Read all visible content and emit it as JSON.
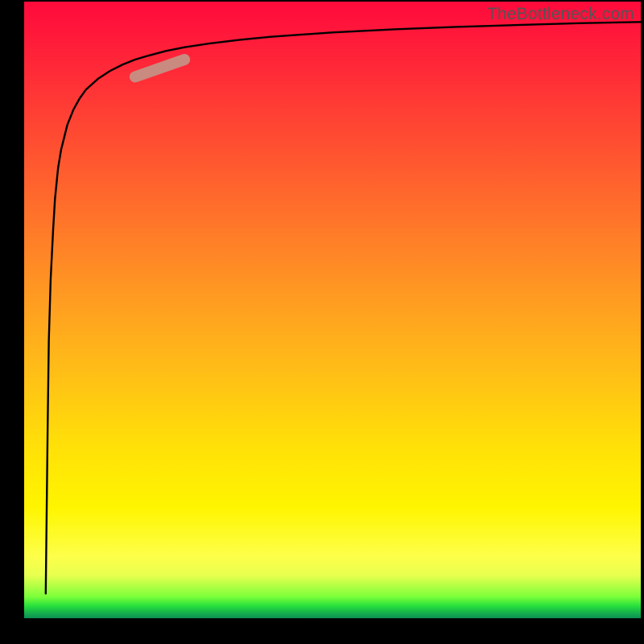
{
  "watermark": "TheBottleneck.com",
  "colors": {
    "curve": "#000000",
    "marker_fill": "#c98a80",
    "marker_stroke": "#a56a60",
    "frame": "#000000"
  },
  "chart_data": {
    "type": "line",
    "title": "",
    "xlabel": "",
    "ylabel": "",
    "xlim": [
      0,
      100
    ],
    "ylim": [
      0,
      100
    ],
    "series": [
      {
        "name": "curve",
        "x": [
          3.5,
          3.8,
          4,
          4.3,
          4.7,
          5,
          5.5,
          6,
          7,
          8,
          9,
          10,
          12,
          14,
          16,
          18,
          20,
          23,
          26,
          30,
          35,
          40,
          50,
          60,
          70,
          80,
          90,
          100
        ],
        "y": [
          4,
          30,
          45,
          55,
          63,
          68,
          73,
          76,
          80,
          82.5,
          84.3,
          85.7,
          87.5,
          88.8,
          89.8,
          90.6,
          91.2,
          92,
          92.6,
          93.2,
          93.8,
          94.3,
          95,
          95.5,
          95.9,
          96.2,
          96.5,
          96.7
        ]
      }
    ],
    "marker": {
      "comment": "pink capsule highlight along the curve",
      "x_start": 18,
      "y_start": 87.8,
      "x_end": 26,
      "y_end": 90.6
    },
    "gradient_bands": {
      "comment": "background color bands top(red)->bottom(green), y in percent of height from top",
      "stops": [
        {
          "y_pct": 0,
          "color": "#ff0a3c"
        },
        {
          "y_pct": 46,
          "color": "#ff9523"
        },
        {
          "y_pct": 82,
          "color": "#fff500"
        },
        {
          "y_pct": 97,
          "color": "#27e03d"
        },
        {
          "y_pct": 100,
          "color": "#0d8f53"
        }
      ]
    }
  }
}
